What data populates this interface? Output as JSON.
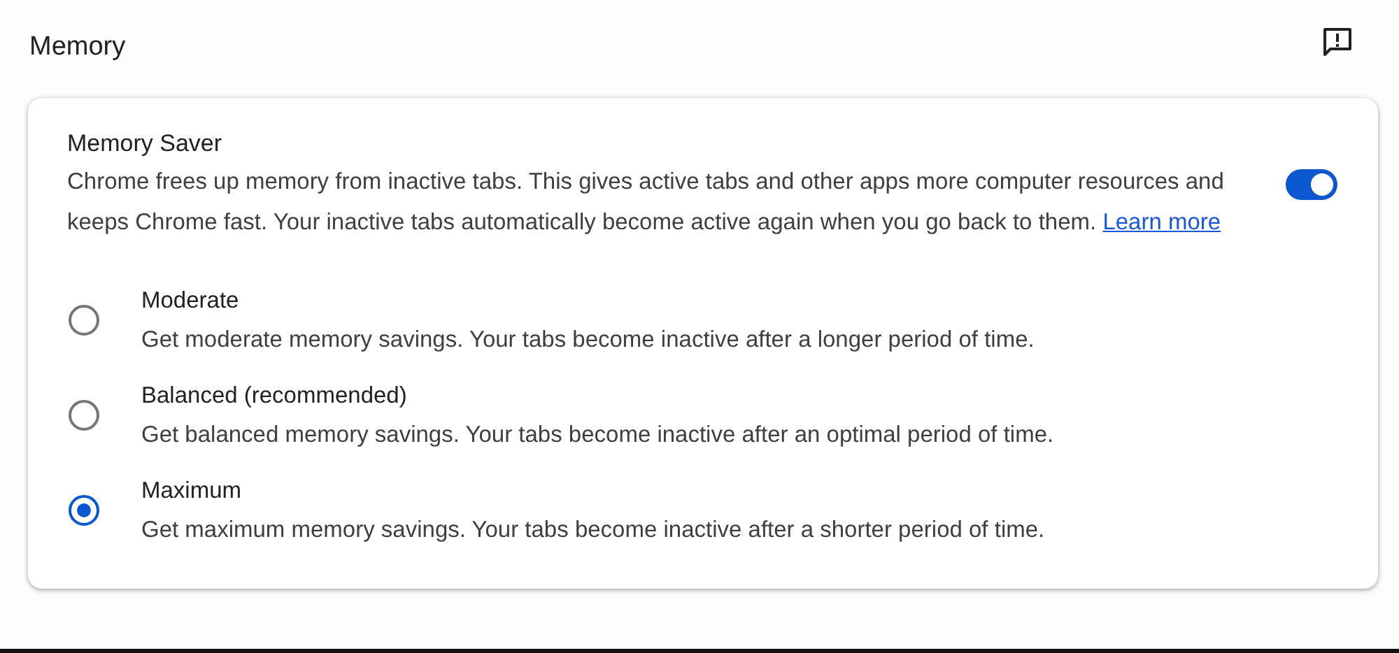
{
  "section": {
    "title": "Memory"
  },
  "memory_saver": {
    "title": "Memory Saver",
    "description": "Chrome frees up memory from inactive tabs. This gives active tabs and other apps more computer resources and keeps Chrome fast. Your inactive tabs automatically become active again when you go back to them.",
    "link": "Learn more",
    "on": true
  },
  "options": [
    {
      "label": "Moderate",
      "description": "Get moderate memory savings. Your tabs become inactive after a longer period of time.",
      "selected": false
    },
    {
      "label": "Balanced (recommended)",
      "description": "Get balanced memory savings. Your tabs become inactive after an optimal period of time.",
      "selected": false
    },
    {
      "label": "Maximum",
      "description": "Get maximum memory savings. Your tabs become inactive after a shorter period of time.",
      "selected": true
    }
  ]
}
